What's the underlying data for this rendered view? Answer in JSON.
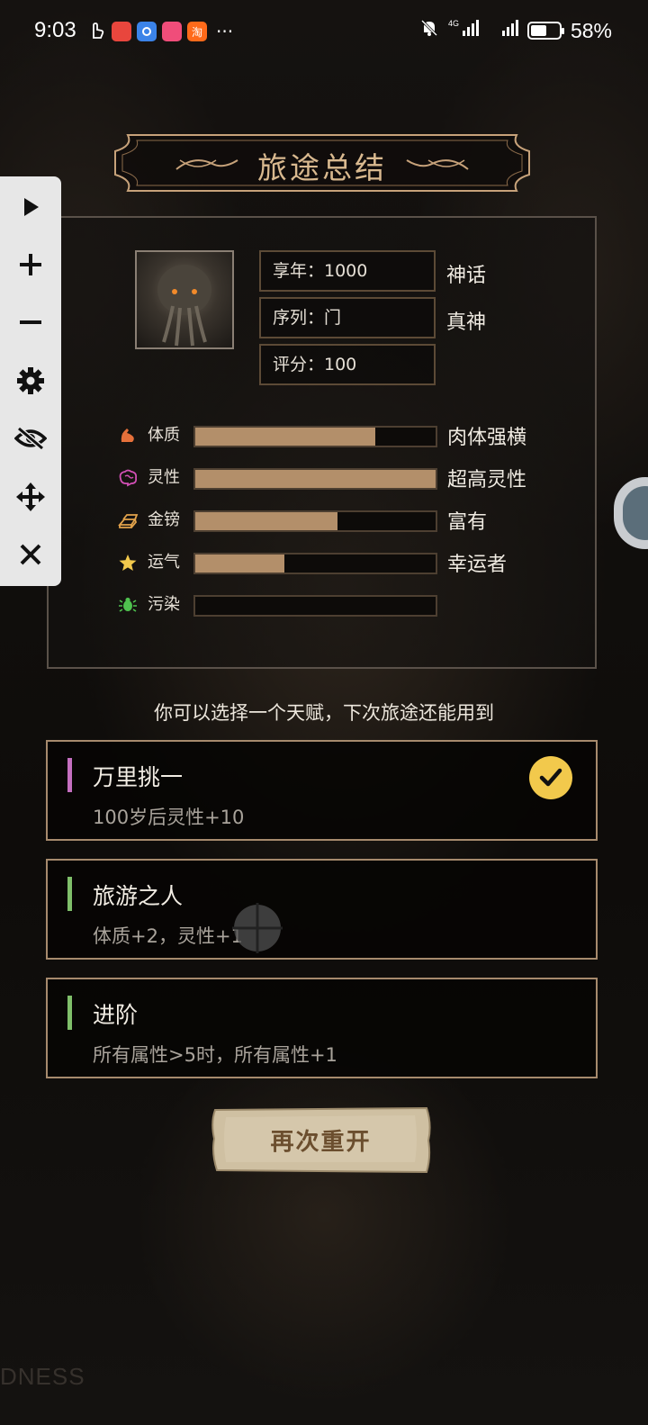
{
  "status_bar": {
    "time": "9:03",
    "network": "4G",
    "battery_percent": "58%",
    "battery_level": 0.58,
    "app_icons": [
      "hand-icon",
      "app-red-icon",
      "app-blue-icon",
      "app-pink-icon",
      "taobao-icon"
    ],
    "taobao_glyph": "淘",
    "more": "···"
  },
  "title": "旅途总结",
  "toolbar": {
    "items": [
      "play-icon",
      "plus-icon",
      "minus-icon",
      "gear-icon",
      "eye-slash-icon",
      "move-icon",
      "close-icon"
    ]
  },
  "summary": {
    "age": "享年：1000",
    "age_tag": "神话",
    "sequence": "序列：门",
    "sequence_tag": "真神",
    "score": "评分：100",
    "attributes": [
      {
        "name": "体质",
        "icon": "muscle-icon",
        "level": 0.75,
        "desc": "肉体强横",
        "color": "#e6703a"
      },
      {
        "name": "灵性",
        "icon": "brain-icon",
        "level": 1.0,
        "desc": "超高灵性",
        "color": "#d24fb5"
      },
      {
        "name": "金镑",
        "icon": "gold-icon",
        "level": 0.59,
        "desc": "富有",
        "color": "#e2a24b"
      },
      {
        "name": "运气",
        "icon": "star-icon",
        "level": 0.37,
        "desc": "幸运者",
        "color": "#f2c94c"
      },
      {
        "name": "污染",
        "icon": "bug-icon",
        "level": 0.0,
        "desc": "",
        "color": "#4fc24f"
      }
    ]
  },
  "hint": "你可以选择一个天赋，下次旅途还能用到",
  "talents": [
    {
      "name": "万里挑一",
      "desc": "100岁后灵性+10",
      "stripe": "#c46fc0",
      "selected": true
    },
    {
      "name": "旅游之人",
      "desc": "体质+2，灵性+1",
      "stripe": "#7fbf6a",
      "selected": false
    },
    {
      "name": "进阶",
      "desc": "所有属性>5时，所有属性+1",
      "stripe": "#7fbf6a",
      "selected": false
    }
  ],
  "restart_label": "再次重开",
  "watermark": "DNESS"
}
